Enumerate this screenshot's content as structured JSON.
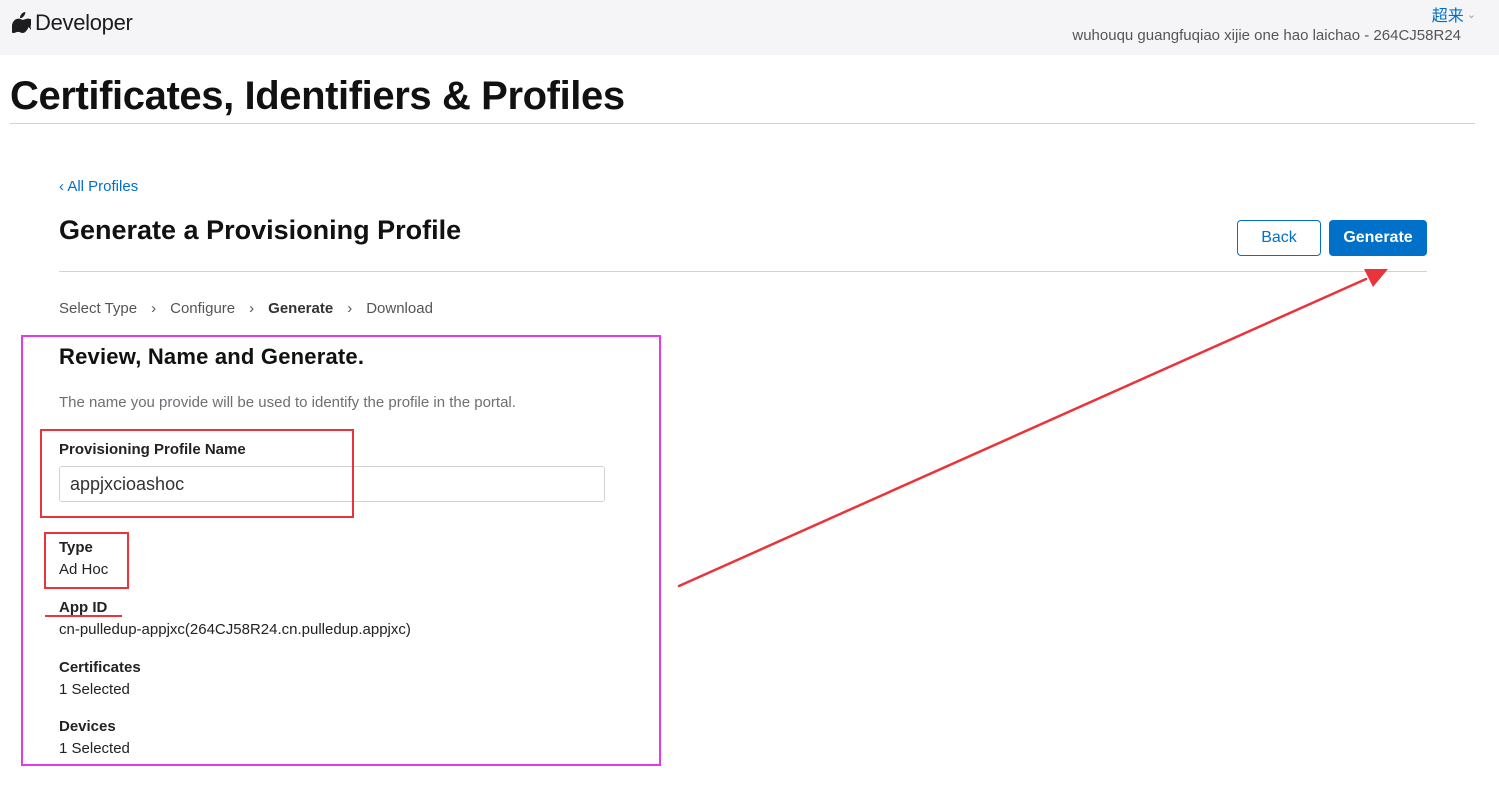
{
  "header": {
    "brand_label": "Developer",
    "account_name": "超来",
    "team_info": "wuhouqu guangfuqiao xijie one hao laichao - 264CJ58R24"
  },
  "page": {
    "title": "Certificates, Identifiers & Profiles"
  },
  "nav": {
    "back_link": "‹ All Profiles"
  },
  "section": {
    "title": "Generate a Provisioning Profile",
    "back_button": "Back",
    "generate_button": "Generate"
  },
  "stepper": {
    "steps": [
      {
        "label": "Select Type"
      },
      {
        "label": "Configure"
      },
      {
        "label": "Generate",
        "current": true
      },
      {
        "label": "Download"
      }
    ],
    "separator": "›"
  },
  "form": {
    "heading": "Review, Name and Generate.",
    "description": "The name you provide will be used to identify the profile in the portal.",
    "name_label": "Provisioning Profile Name",
    "name_value": "appjxcioashoc",
    "type_label": "Type",
    "type_value": "Ad Hoc",
    "appid_label": "App ID",
    "appid_value": "cn-pulledup-appjxc(264CJ58R24.cn.pulledup.appjxc)",
    "certificates_label": "Certificates",
    "certificates_value": "1 Selected",
    "devices_label": "Devices",
    "devices_value": "1 Selected"
  },
  "colors": {
    "accent": "#0070c9",
    "annotation_magenta": "#e23be6",
    "annotation_red": "#e8343a",
    "header_bg": "#f5f5f7"
  },
  "icons": {
    "brand": "apple-logo-icon",
    "account_dropdown": "chevron-down-icon",
    "step_separator": "chevron-right-icon"
  }
}
